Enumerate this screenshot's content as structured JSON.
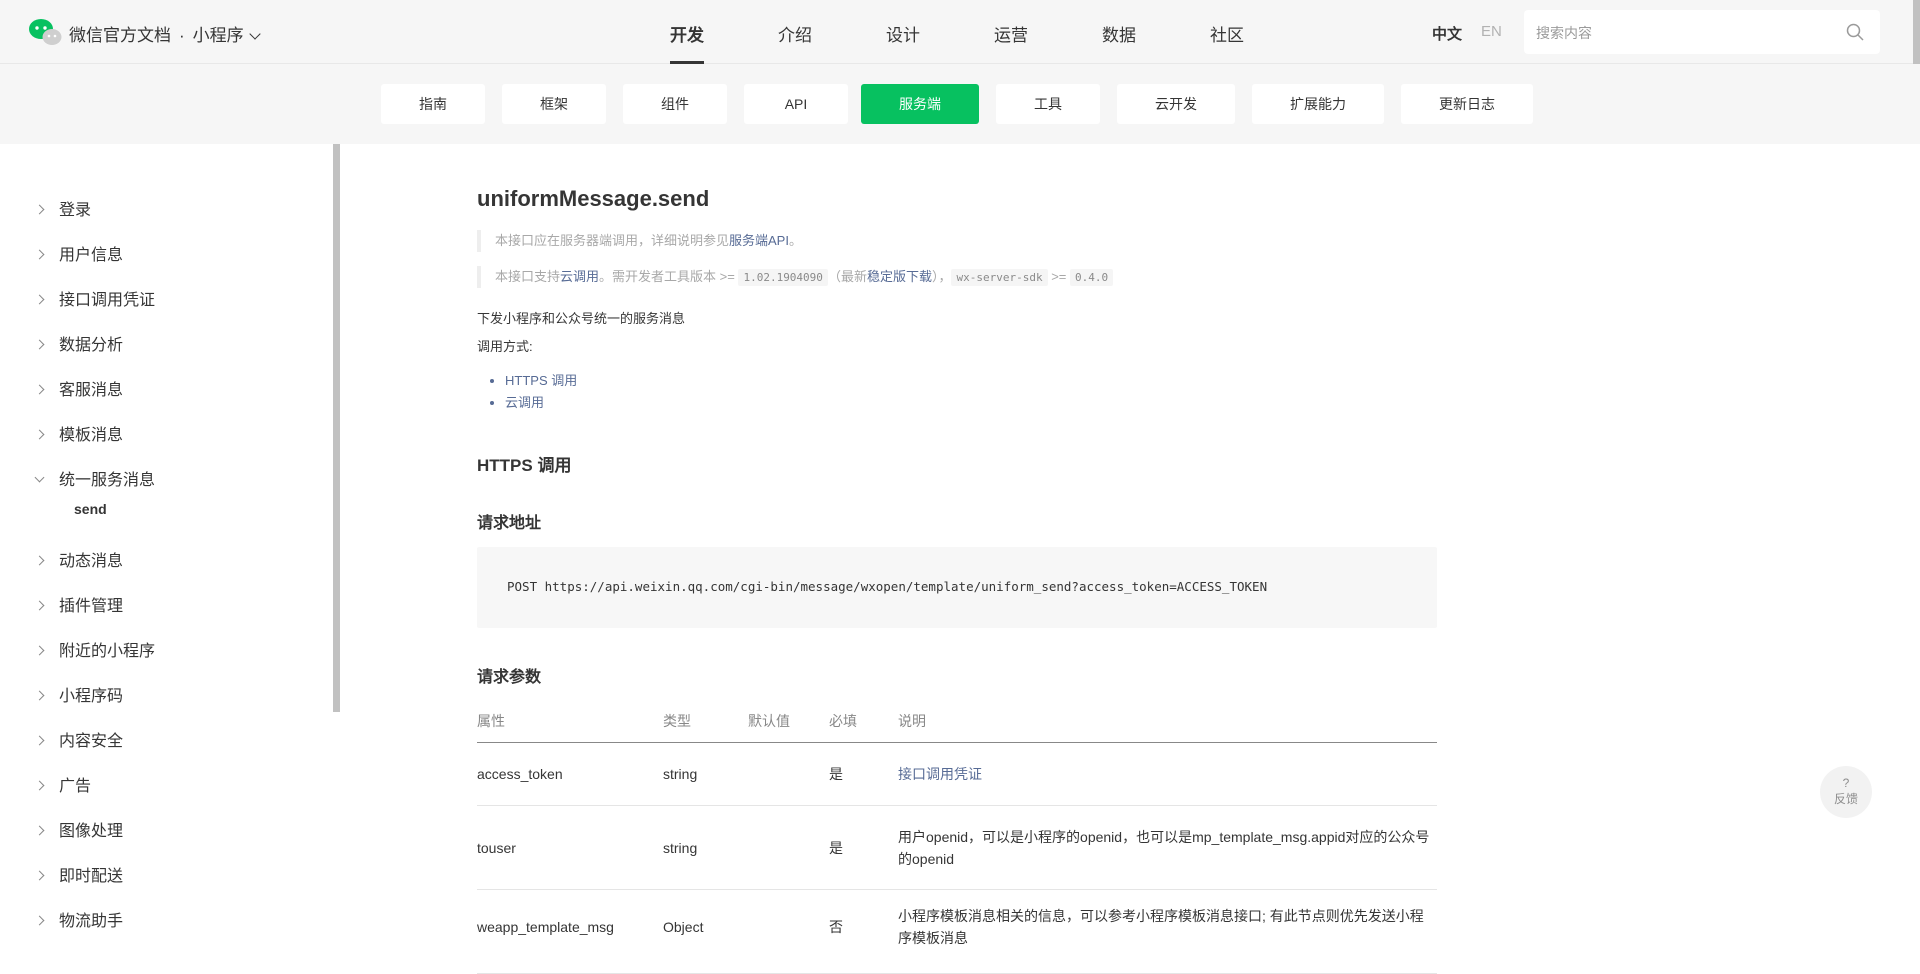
{
  "header": {
    "brand": "微信官方文档",
    "dot": "·",
    "product": "小程序",
    "nav": [
      "开发",
      "介绍",
      "设计",
      "运营",
      "数据",
      "社区"
    ],
    "active_nav": "开发",
    "lang_zh": "中文",
    "lang_en": "EN",
    "search_placeholder": "搜索内容"
  },
  "subnav": {
    "items": [
      "指南",
      "框架",
      "组件",
      "API",
      "服务端",
      "工具",
      "云开发",
      "扩展能力",
      "更新日志"
    ],
    "active": "服务端",
    "accent_color": "#07c160"
  },
  "sidebar": {
    "items": [
      "登录",
      "用户信息",
      "接口调用凭证",
      "数据分析",
      "客服消息",
      "模板消息",
      "统一服务消息",
      "动态消息",
      "插件管理",
      "附近的小程序",
      "小程序码",
      "内容安全",
      "广告",
      "图像处理",
      "即时配送",
      "物流助手"
    ],
    "open_item": "统一服务消息",
    "sub_item": "send"
  },
  "content": {
    "title": "uniformMessage.send",
    "note1_prefix": "本接口应在服务器端调用，详细说明参见",
    "note1_link": "服务端API",
    "note1_suffix": "。",
    "note2_prefix": "本接口支持",
    "note2_link1": "云调用",
    "note2_mid1": "。需开发者工具版本 >= ",
    "note2_code1": "1.02.1904090",
    "note2_mid2": "（最新",
    "note2_link2": "稳定版下载",
    "note2_mid3": "），",
    "note2_code2": "wx-server-sdk",
    "note2_mid4": " >= ",
    "note2_code3": "0.4.0",
    "desc": "下发小程序和公众号统一的服务消息",
    "call_methods_label": "调用方式:",
    "call_methods": [
      "HTTPS 调用",
      "云调用"
    ],
    "section_https": "HTTPS 调用",
    "request_url_heading": "请求地址",
    "request_url": "POST https://api.weixin.qq.com/cgi-bin/message/wxopen/template/uniform_send?access_token=ACCESS_TOKEN",
    "request_params_heading": "请求参数",
    "table_headers": [
      "属性",
      "类型",
      "默认值",
      "必填",
      "说明"
    ],
    "table_rows": [
      {
        "name": "access_token",
        "type": "string",
        "default": "",
        "required": "是",
        "desc": "",
        "desc_link": "接口调用凭证"
      },
      {
        "name": "touser",
        "type": "string",
        "default": "",
        "required": "是",
        "desc": "用户openid，可以是小程序的openid，也可以是mp_template_msg.appid对应的公众号的openid",
        "desc_link": ""
      },
      {
        "name": "weapp_template_msg",
        "type": "Object",
        "default": "",
        "required": "否",
        "desc": "小程序模板消息相关的信息，可以参考小程序模板消息接口; 有此节点则优先发送小程序模板消息",
        "desc_link": ""
      }
    ]
  },
  "feedback": {
    "icon": "?",
    "label": "反馈"
  }
}
